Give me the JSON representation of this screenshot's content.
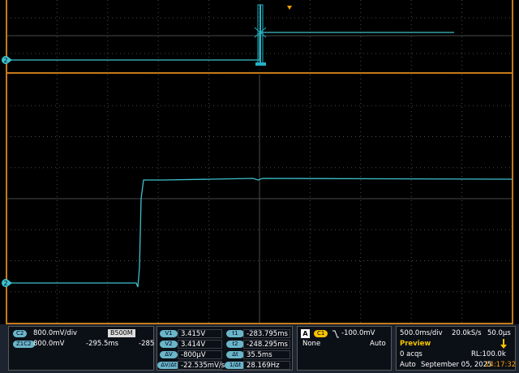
{
  "colors": {
    "trace": "#3ec1cc",
    "frame": "#c77a1a",
    "grid": "#4a4a4a",
    "cursor": "#22b3c5",
    "accent": "#f5c400"
  },
  "markers": {
    "ch_label": "2",
    "upper_ch_label": "2",
    "trigger_icon": "trigger-position-icon"
  },
  "channels": {
    "c2": {
      "tag": "C2",
      "scale": "800.0mV/div",
      "bw_tag": "B",
      "bw_value": "500M"
    },
    "z": {
      "tag": "Z1C2",
      "scale": "800.0mV",
      "pos": "-295.5ms",
      "extra": "-285"
    }
  },
  "cursors": {
    "v1": {
      "tag": "V1",
      "value": "3.415V"
    },
    "v2": {
      "tag": "V2",
      "value": "3.414V"
    },
    "dv": {
      "tag": "ΔV",
      "value": "-800µV"
    },
    "dvdt": {
      "tag": "ΔV/Δt",
      "value": "-22.535mV/s"
    },
    "t1": {
      "tag": "t1",
      "value": "-283.795ms"
    },
    "t2": {
      "tag": "t2",
      "value": "-248.295ms"
    },
    "dt": {
      "tag": "Δt",
      "value": "35.5ms"
    },
    "f": {
      "tag": "1/Δt",
      "value": "28.169Hz"
    }
  },
  "trigger": {
    "mode_tag": "A",
    "source": "C1",
    "level": "-100.0mV",
    "coupling": "None",
    "mode": "Auto"
  },
  "acquisition": {
    "timebase": "500.0ms/div",
    "rate": "20.0kS/s",
    "resolution": "50.0µs",
    "state": "Preview",
    "acqs": "0 acqs",
    "rl": "RL:100.0k",
    "mode": "Auto",
    "date": "September 05, 2025",
    "time": "14:17:32"
  }
}
